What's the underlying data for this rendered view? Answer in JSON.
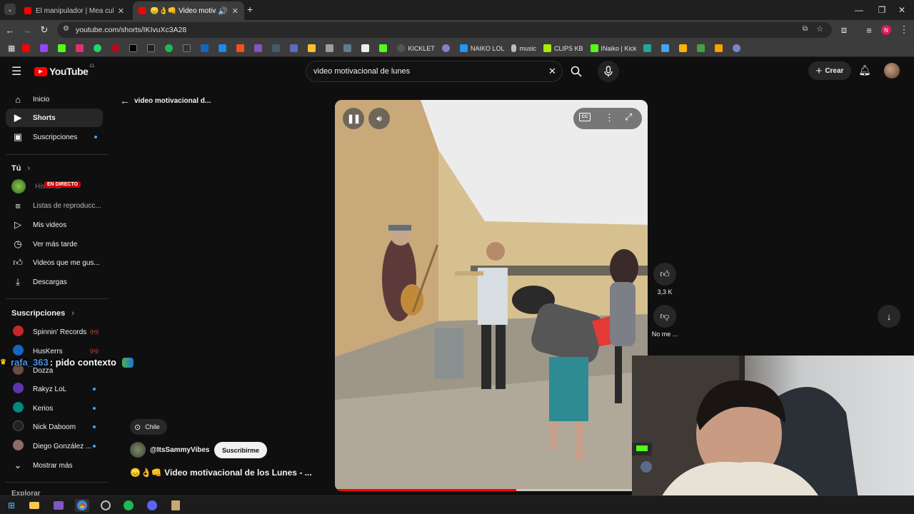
{
  "browser": {
    "tabs": [
      {
        "title": "El manipulador | Mea culpa - T",
        "active": false
      },
      {
        "title": "😞👌👊 Video motivacional",
        "active": true
      }
    ],
    "new_tab_symbol": "+",
    "url": "youtube.com/shorts/IKIvuXc3A28",
    "profile_initial": "N",
    "bookmarks": [
      "KICKLET",
      "NAIKO LOL",
      "music",
      "CLIPS KB",
      "INaiko | Kick"
    ]
  },
  "youtube": {
    "logo_text": "YouTube",
    "country_code": "CL",
    "search_value": "video motivacional de lunes",
    "create_label": "Crear"
  },
  "sidebar": {
    "main_items": [
      {
        "label": "Inicio",
        "icon": "home-icon"
      },
      {
        "label": "Shorts",
        "icon": "shorts-icon"
      },
      {
        "label": "Suscripciones",
        "icon": "subscriptions-icon"
      }
    ],
    "you_heading": "Tú",
    "you_items": [
      {
        "label": "Historial",
        "icon": "history-icon"
      },
      {
        "label": "Listas de reproducc...",
        "icon": "playlist-icon"
      },
      {
        "label": "Mis videos",
        "icon": "my-videos-icon"
      },
      {
        "label": "Ver más tarde",
        "icon": "clock-icon"
      },
      {
        "label": "Videos que me gus...",
        "icon": "thumb-up-icon"
      },
      {
        "label": "Descargas",
        "icon": "download-icon"
      }
    ],
    "live_badge": "EN DIRECTO",
    "subs_heading": "Suscripciones",
    "channels": [
      {
        "name": "Spinnin' Records",
        "color": "#c62828"
      },
      {
        "name": "HusKerrs",
        "color": "#1565c0"
      },
      {
        "name": "Dozza",
        "color": "#6d4c41"
      },
      {
        "name": "Rakyz LoL",
        "color": "#5e35b1"
      },
      {
        "name": "Kerios",
        "color": "#00897b"
      },
      {
        "name": "Nick Daboom",
        "color": "#212121"
      },
      {
        "name": "Diego González ...",
        "color": "#8d6e63"
      }
    ],
    "show_more": "Mostrar más",
    "explore_heading": "Explorar"
  },
  "short": {
    "back_title": "video motivacional d...",
    "location": "Chile",
    "channel": "@ItsSammyVibes",
    "subscribe_label": "Suscribirme",
    "title": "😞👌👊 Video motivacional de los Lunes - ...",
    "likes": "3,3 K",
    "dislike_label": "No me ...",
    "progress": 0.58
  },
  "overlay": {
    "chat_user": "rafa_363",
    "chat_message": ": pido contexto"
  },
  "colors": {
    "accent_red": "#ff0000",
    "link_blue": "#3ea6ff",
    "chat_user": "#4a90e2"
  }
}
